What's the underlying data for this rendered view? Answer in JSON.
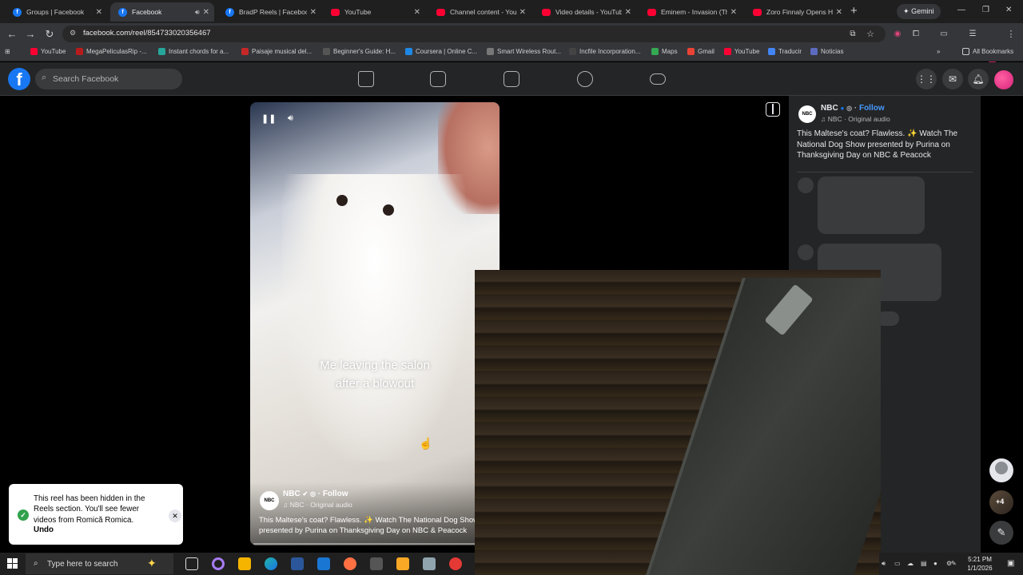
{
  "browser": {
    "tabs": [
      {
        "title": "Groups | Facebook",
        "icon": "facebook-icon",
        "active": false
      },
      {
        "title": "Facebook",
        "icon": "facebook-icon",
        "active": true
      },
      {
        "title": "BradP Reels | Facebook",
        "icon": "facebook-icon",
        "active": false
      },
      {
        "title": "YouTube",
        "icon": "youtube-icon",
        "active": false
      },
      {
        "title": "Channel content - YouT",
        "icon": "youtube-studio-icon",
        "active": false
      },
      {
        "title": "Video details - YouTube",
        "icon": "youtube-studio-icon",
        "active": false
      },
      {
        "title": "Eminem - Invasion (The",
        "icon": "youtube-icon",
        "active": false
      },
      {
        "title": "Zoro Finnaly Opens His",
        "icon": "youtube-icon",
        "active": false
      }
    ],
    "gemini_label": "Gemini",
    "url": "facebook.com/reel/854733020356467",
    "bookmarks": [
      "YouTube",
      "MegaPeliculasRip -...",
      "Instant chords for a...",
      "Paisaje musical del...",
      "Beginner's Guide: H...",
      "Coursera | Online C...",
      "Smart Wireless Rout...",
      "Incfile Incorporation...",
      "Maps",
      "Gmail",
      "YouTube",
      "Traducir",
      "Noticias"
    ],
    "all_bookmarks_label": "All Bookmarks",
    "profile_initial": "G"
  },
  "facebook": {
    "search_placeholder": "Search Facebook",
    "logo_letter": "f"
  },
  "reel": {
    "caption_line1": "Me leaving the salon",
    "caption_line2": "after a blowout",
    "author": "NBC",
    "follow_label": "Follow",
    "audio": "NBC · Original audio",
    "description": "This Maltese's coat? Flawless. ✨ Watch The National Dog Show presented by Purina on Thanksgiving Day on NBC & Peacock",
    "logo_text": "NBC"
  },
  "side_panel": {
    "author": "NBC",
    "follow_label": "Follow",
    "audio": "NBC · Original audio",
    "description": "This Maltese's coat? Flawless. ✨ Watch The National Dog Show presented by Purina on Thanksgiving Day on NBC & Peacock"
  },
  "toast": {
    "message": "This reel has been hidden in the Reels section. You'll see fewer videos from Romică Romica.",
    "undo_label": "Undo"
  },
  "floating": {
    "badge": "+4"
  },
  "taskbar": {
    "search_placeholder": "Type here to search",
    "time": "5:21 PM",
    "date": "1/1/2026"
  },
  "colors": {
    "facebook_blue": "#1877f2",
    "follow_blue": "#4599ff",
    "toast_check": "#31a24c"
  }
}
